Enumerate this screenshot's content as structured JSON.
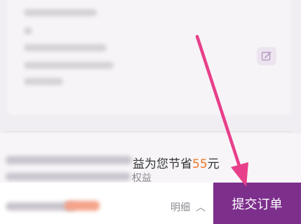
{
  "member": {
    "saving_prefix": "益为您节省",
    "saving_amount": "55",
    "saving_suffix": "元",
    "rights_suffix": "权益"
  },
  "footer": {
    "detail_label": "明细",
    "submit_label": "提交订单"
  },
  "icons": {
    "edit": "edit-icon",
    "chevron": "chevron-up-icon",
    "annotation": "arrow-annotation"
  },
  "colors": {
    "accent": "#7d2f8c",
    "saving": "#f0772a",
    "annotation": "#e83f8a"
  }
}
